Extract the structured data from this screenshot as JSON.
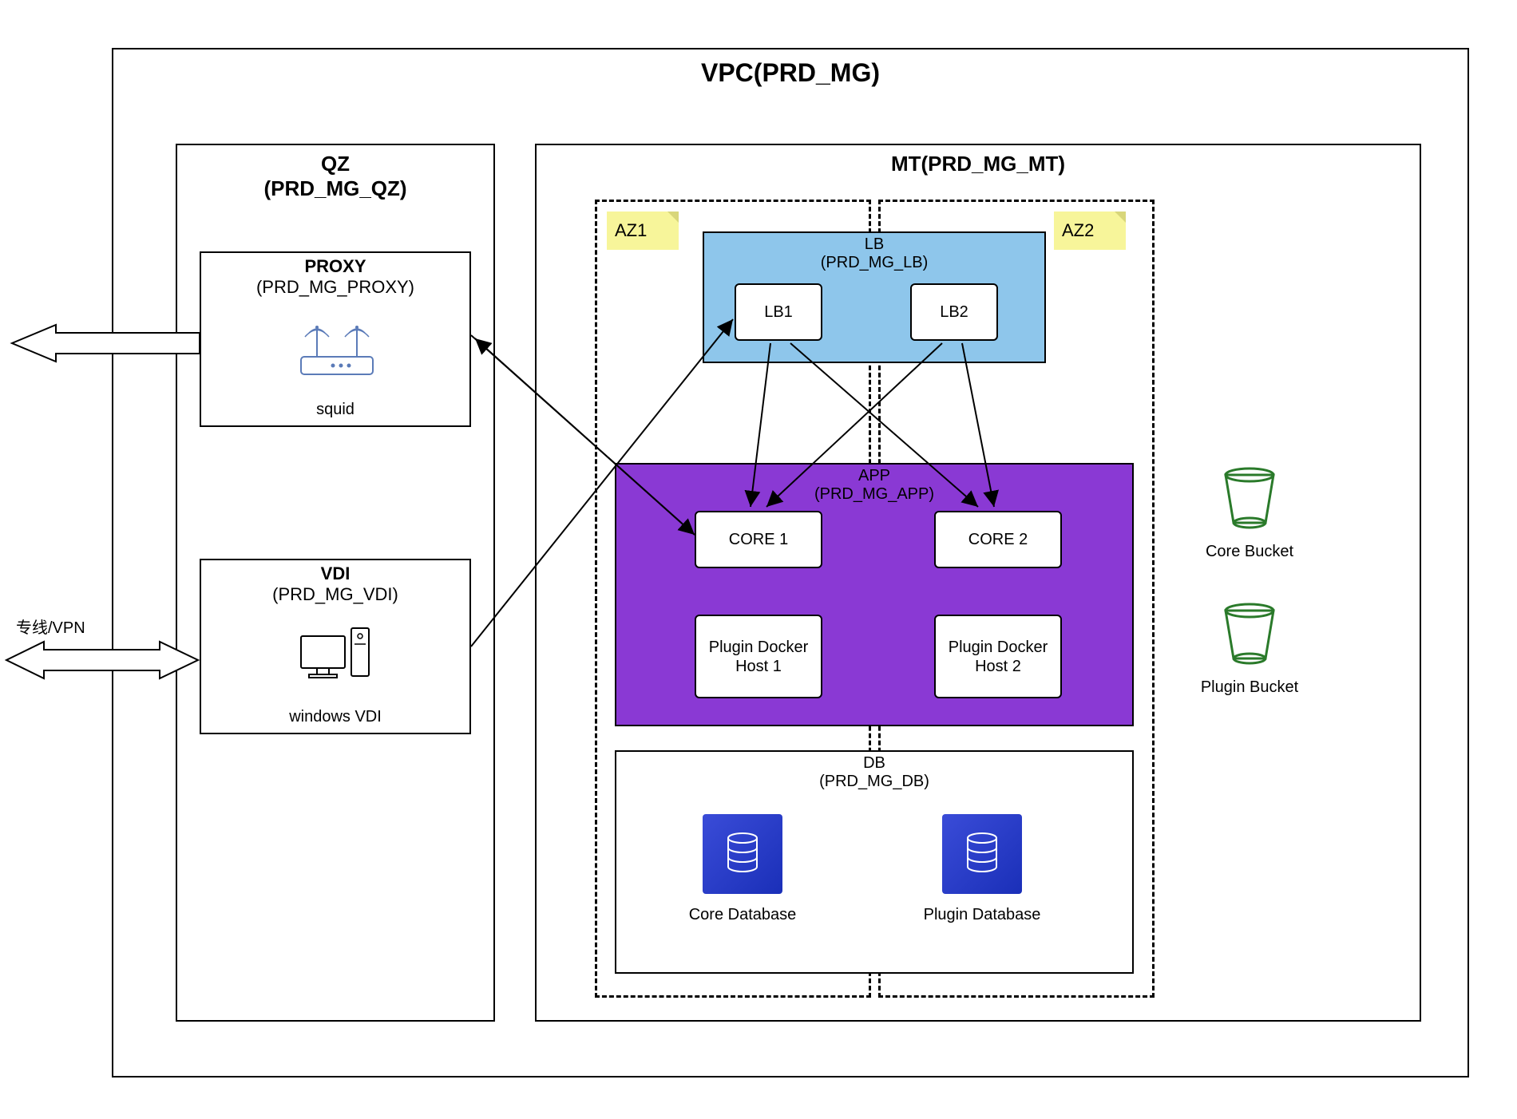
{
  "vpc": {
    "title": "VPC(PRD_MG)"
  },
  "qz": {
    "title": "QZ",
    "subtitle": "(PRD_MG_QZ)",
    "proxy": {
      "title": "PROXY",
      "subtitle": "(PRD_MG_PROXY)",
      "label": "squid"
    },
    "vdi": {
      "title": "VDI",
      "subtitle": "(PRD_MG_VDI)",
      "label": "windows VDI"
    }
  },
  "mt": {
    "title": "MT(PRD_MG_MT)",
    "az1": "AZ1",
    "az2": "AZ2",
    "lb": {
      "title": "LB",
      "subtitle": "(PRD_MG_LB)",
      "lb1": "LB1",
      "lb2": "LB2"
    },
    "app": {
      "title": "APP",
      "subtitle": "(PRD_MG_APP)",
      "core1": "CORE 1",
      "core2": "CORE 2",
      "plugin1": "Plugin Docker Host 1",
      "plugin2": "Plugin Docker Host 2"
    },
    "db": {
      "title": "DB",
      "subtitle": "(PRD_MG_DB)",
      "core": "Core Database",
      "plugin": "Plugin Database"
    },
    "buckets": {
      "core": "Core Bucket",
      "plugin": "Plugin Bucket"
    }
  },
  "external": {
    "vpn": "专线/VPN"
  }
}
